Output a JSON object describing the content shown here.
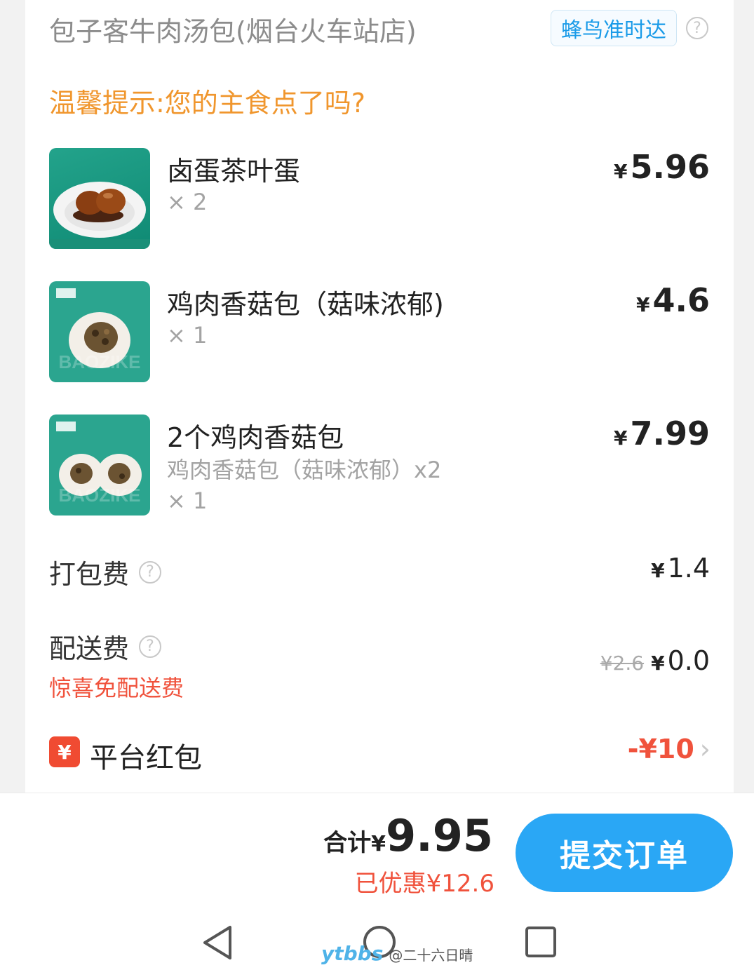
{
  "store": {
    "name": "包子客牛肉汤包(烟台火车站店)",
    "delivery_badge": "蜂鸟准时达",
    "help": "?"
  },
  "tip": "温馨提示:您的主食点了吗?",
  "items": [
    {
      "name": "卤蛋茶叶蛋",
      "sub": "",
      "qty": "× 2",
      "currency": "¥",
      "price": "5.96",
      "image_icon": "tea-egg-image"
    },
    {
      "name": "鸡肉香菇包（菇味浓郁)",
      "sub": "",
      "qty": "× 1",
      "currency": "¥",
      "price": "4.6",
      "image_icon": "bun-image"
    },
    {
      "name": "2个鸡肉香菇包",
      "sub": "鸡肉香菇包（菇味浓郁）x2",
      "qty": "× 1",
      "currency": "¥",
      "price": "7.99",
      "image_icon": "two-buns-image"
    }
  ],
  "packing": {
    "label": "打包费",
    "currency": "¥",
    "value": "1.4"
  },
  "delivery": {
    "label": "配送费",
    "promo": "惊喜免配送费",
    "original": "¥2.6",
    "currency": "¥",
    "value": "0.0"
  },
  "redpack": {
    "icon": "¥",
    "label": "平台红包",
    "value": "-¥10"
  },
  "bottom": {
    "total_label": "合计",
    "total_currency": "¥",
    "total_value": "9.95",
    "saved": "已优惠¥12.6",
    "submit": "提交订单"
  },
  "watermark": {
    "logo": "ytbbs",
    "text": "@二十六日晴"
  },
  "colors": {
    "accent_blue": "#2aa7f5",
    "tip_orange": "#f0962d",
    "promo_red": "#f0523c",
    "thumb_teal": "#2ba58f"
  }
}
